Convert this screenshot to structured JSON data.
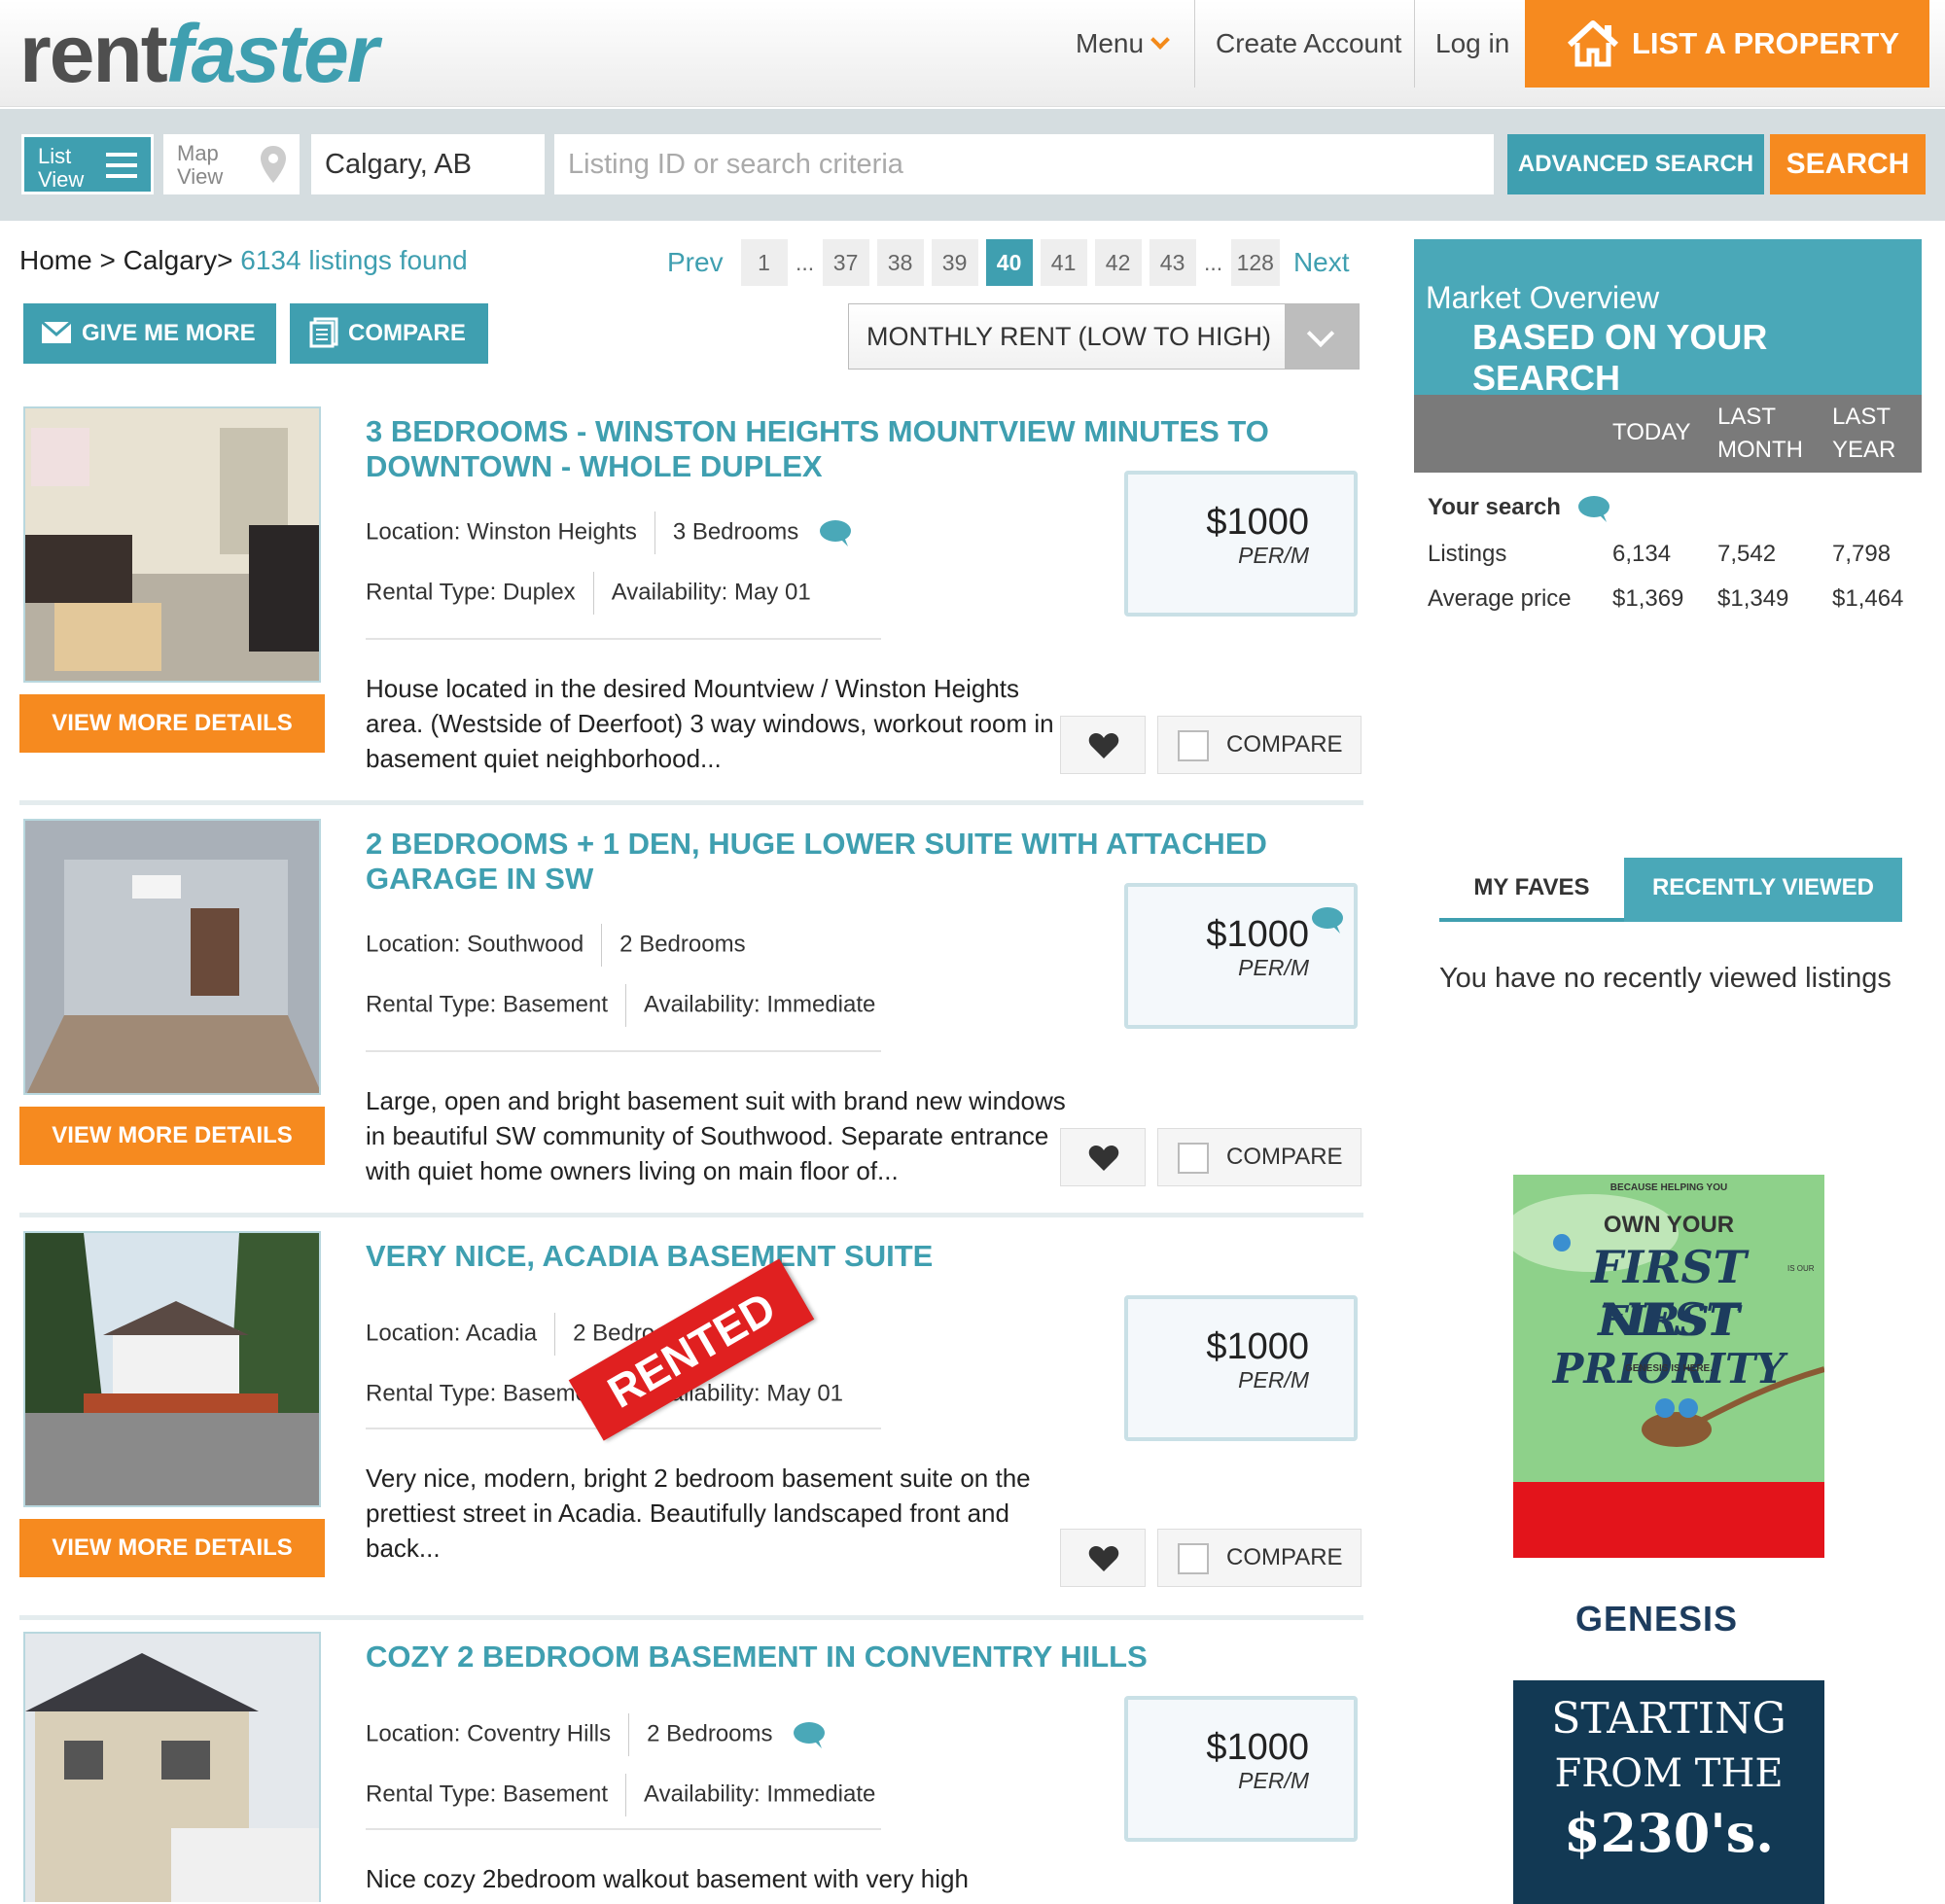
{
  "header": {
    "logo_part1": "rent",
    "logo_part2": "faster",
    "menu_label": "Menu",
    "create_account": "Create Account",
    "log_in": "Log in",
    "list_property": "LIST A PROPERTY"
  },
  "search": {
    "list_view_line1": "List",
    "list_view_line2": "View",
    "map_view_line1": "Map",
    "map_view_line2": "View",
    "city_value": "Calgary, AB",
    "criteria_placeholder": "Listing ID or search criteria",
    "advanced_label": "ADVANCED SEARCH",
    "search_label": "SEARCH"
  },
  "breadcrumb": {
    "home": "Home",
    "sep": ">",
    "city": "Calgary",
    "sep2": ">",
    "found": "6134 listings found"
  },
  "pagination": {
    "prev": "Prev",
    "next": "Next",
    "pages": [
      "1",
      "...",
      "37",
      "38",
      "39",
      "40",
      "41",
      "42",
      "43",
      "...",
      "128"
    ],
    "active": "40"
  },
  "actions": {
    "give_me_more": "GIVE ME MORE",
    "compare": "COMPARE",
    "sort_value": "MONTHLY RENT (LOW TO HIGH)"
  },
  "listings": [
    {
      "title": "3 BEDROOMS - WINSTON HEIGHTS MOUNTVIEW MINUTES TO DOWNTOWN - WHOLE DUPLEX",
      "location": "Location: Winston Heights",
      "bedrooms": "3 Bedrooms",
      "rental_type": "Rental Type: Duplex",
      "availability": "Availability: May 01",
      "description": "House located in the desired Mountview / Winston Heights area. (Westside of Deerfoot)  3 way windows, workout room in basement quiet neighborhood...",
      "price": "$1000",
      "per": "PER/M",
      "view_more": "VIEW MORE DETAILS",
      "compare": "COMPARE"
    },
    {
      "title": "2 BEDROOMS + 1 DEN, HUGE LOWER SUITE WITH ATTACHED GARAGE IN SW",
      "location": "Location: Southwood",
      "bedrooms": "2 Bedrooms",
      "rental_type": "Rental Type: Basement",
      "availability": "Availability: Immediate",
      "description": "Large, open and bright basement suit with brand new windows in beautiful SW community of Southwood. Separate entrance with quiet home owners living on main floor of...",
      "price": "$1000",
      "per": "PER/M",
      "view_more": "VIEW MORE DETAILS",
      "compare": "COMPARE"
    },
    {
      "title": "VERY NICE, ACADIA BASEMENT SUITE",
      "location": "Location: Acadia",
      "bedrooms": "2 Bedrooms",
      "rental_type": "Rental Type: Basement",
      "availability": "Availability: May 01",
      "description": "Very nice, modern, bright 2 bedroom basement suite on the prettiest street in Acadia. Beautifully landscaped front and back...",
      "price": "$1000",
      "per": "PER/M",
      "view_more": "VIEW MORE DETAILS",
      "compare": "COMPARE",
      "stamp": "RENTED"
    },
    {
      "title": "COZY 2 BEDROOM BASEMENT IN CONVENTRY HILLS",
      "location": "Location: Coventry Hills",
      "bedrooms": "2 Bedrooms",
      "rental_type": "Rental Type: Basement",
      "availability": "Availability: Immediate",
      "description": "Nice cozy 2bedroom walkout  basement with very high",
      "price": "$1000",
      "per": "PER/M",
      "view_more": "VIEW MORE DETAILS",
      "compare": "COMPARE"
    }
  ],
  "market": {
    "title1": "Market Overview",
    "title2": "BASED ON YOUR SEARCH",
    "col_today": "TODAY",
    "col_last_month_1": "LAST",
    "col_last_month_2": "MONTH",
    "col_last_year_1": "LAST",
    "col_last_year_2": "YEAR",
    "your_search": "Your search",
    "rows": [
      {
        "label": "Listings",
        "today": "6,134",
        "last_month": "7,542",
        "last_year": "7,798"
      },
      {
        "label": "Average price",
        "today": "$1,369",
        "last_month": "$1,349",
        "last_year": "$1,464"
      }
    ]
  },
  "sidebar_tabs": {
    "my_faves": "MY FAVES",
    "recently_viewed": "RECENTLY VIEWED",
    "empty_message": "You have no recently viewed listings"
  },
  "ads": {
    "ad1_small_top": "BECAUSE HELPING YOU",
    "ad1_line1": "OWN YOUR",
    "ad1_line2": "FIRST NEST",
    "ad1_line3": "FIRST PRIORITY",
    "ad1_small_side": "IS OUR",
    "ad1_small_bottom": "GENESIS IS HERE.",
    "genesis": "GENESIS",
    "ad2_line1": "STARTING",
    "ad2_line2": "FROM THE",
    "ad2_line3": "$230's."
  },
  "colors": {
    "teal": "#3f9fb0",
    "orange": "#f68a1f",
    "stamp_red": "#e02020"
  },
  "icons": [
    "chevron-down-icon",
    "house-icon",
    "list-icon",
    "map-pin-icon",
    "envelope-icon",
    "document-icon",
    "heart-icon",
    "speech-bubble-icon"
  ]
}
